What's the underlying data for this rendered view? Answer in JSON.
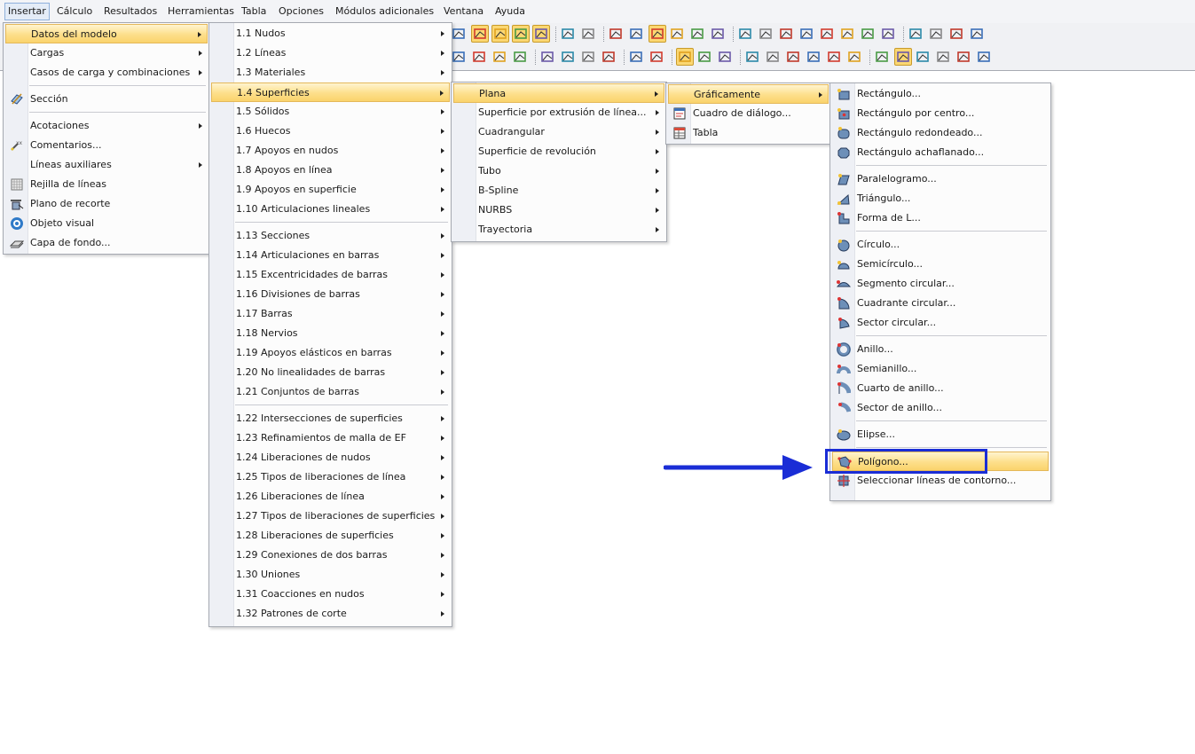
{
  "menubar": {
    "items": [
      {
        "label": "Insertar",
        "active": true
      },
      {
        "label": "Cálculo"
      },
      {
        "label": "Resultados"
      },
      {
        "label": "Herramientas"
      },
      {
        "label": "Tabla"
      },
      {
        "label": "Opciones"
      },
      {
        "label": "Módulos adicionales"
      },
      {
        "label": "Ventana"
      },
      {
        "label": "Ayuda"
      }
    ]
  },
  "toolbar": {
    "accent_highlight": "#fbd772",
    "row1_icons": [
      "chevron-right-icon",
      "node-select-icon",
      "xxx-label-icon",
      "view-icon",
      "xxx-values-icon",
      "rotate-icon",
      "frame-icon",
      "grid-icon",
      "grid-dots-icon",
      "mesh-icon",
      "support-icon",
      "move-icon",
      "structure-icon",
      "search-icon",
      "rotate-3d-icon",
      "circle-icon",
      "mirror-icon",
      "cross-icon",
      "cube-icon",
      "print-icon",
      "gear-icon",
      "flag-icon",
      "flag2-icon",
      "flag3-icon",
      "flag4-icon"
    ],
    "row2_icons": [
      "zoom-icon",
      "search-icon",
      "box-icon",
      "box2-icon",
      "axis-x-icon",
      "axis-y-icon",
      "axis-z-icon",
      "axis-iso-icon",
      "render-icon",
      "display-icon",
      "bracket-icon",
      "chain-icon",
      "result-icon",
      "color-icon",
      "solid-icon",
      "paint-icon",
      "layer-icon",
      "grid-icon",
      "hide-icon",
      "table-icon",
      "notes-icon",
      "wand-icon",
      "cancel-x-icon",
      "window-icon",
      "window2-icon"
    ]
  },
  "menu_insertar": {
    "items": [
      {
        "label": "Datos del modelo",
        "submenu": true,
        "highlighted": true,
        "icon": "none"
      },
      {
        "label": "Cargas",
        "submenu": true
      },
      {
        "label": "Casos de carga y combinaciones",
        "submenu": true
      },
      {
        "label": "Sección",
        "icon": "section-icon"
      },
      {
        "label": "Acotaciones",
        "submenu": true
      },
      {
        "label": "Comentarios...",
        "icon": "comment-icon"
      },
      {
        "label": "Líneas auxiliares",
        "submenu": true
      },
      {
        "label": "Rejilla de líneas",
        "icon": "grid-icon"
      },
      {
        "label": "Plano de recorte",
        "icon": "clip-plane-icon"
      },
      {
        "label": "Objeto visual",
        "icon": "visual-object-icon"
      },
      {
        "label": "Capa de fondo...",
        "icon": "background-layer-icon"
      }
    ]
  },
  "menu_datos": {
    "items": [
      {
        "label": "1.1 Nudos"
      },
      {
        "label": "1.2 Líneas"
      },
      {
        "label": "1.3 Materiales"
      },
      {
        "label": "1.4 Superficies",
        "highlighted": true
      },
      {
        "label": "1.5 Sólidos"
      },
      {
        "label": "1.6 Huecos"
      },
      {
        "label": "1.7 Apoyos en nudos"
      },
      {
        "label": "1.8 Apoyos en línea"
      },
      {
        "label": "1.9 Apoyos en superficie"
      },
      {
        "label": "1.10 Articulaciones lineales"
      },
      {
        "label": "1.13 Secciones"
      },
      {
        "label": "1.14 Articulaciones en barras"
      },
      {
        "label": "1.15 Excentricidades de barras"
      },
      {
        "label": "1.16 Divisiones de barras"
      },
      {
        "label": "1.17 Barras"
      },
      {
        "label": "1.18 Nervios"
      },
      {
        "label": "1.19 Apoyos elásticos en barras"
      },
      {
        "label": "1.20 No linealidades de barras"
      },
      {
        "label": "1.21 Conjuntos de barras"
      },
      {
        "label": "1.22 Intersecciones de superficies"
      },
      {
        "label": "1.23 Refinamientos de malla de EF"
      },
      {
        "label": "1.24 Liberaciones de nudos"
      },
      {
        "label": "1.25 Tipos de liberaciones de línea"
      },
      {
        "label": "1.26 Liberaciones de línea"
      },
      {
        "label": "1.27 Tipos de liberaciones de superficies"
      },
      {
        "label": "1.28 Liberaciones de superficies"
      },
      {
        "label": "1.29 Conexiones de dos barras"
      },
      {
        "label": "1.30 Uniones"
      },
      {
        "label": "1.31 Coacciones en nudos"
      },
      {
        "label": "1.32 Patrones de corte"
      }
    ]
  },
  "menu_superficies": {
    "items": [
      {
        "label": "Plana",
        "highlighted": true
      },
      {
        "label": "Superficie por extrusión de línea..."
      },
      {
        "label": "Cuadrangular"
      },
      {
        "label": "Superficie de revolución"
      },
      {
        "label": "Tubo"
      },
      {
        "label": "B-Spline"
      },
      {
        "label": "NURBS"
      },
      {
        "label": "Trayectoria"
      }
    ]
  },
  "menu_plana": {
    "items": [
      {
        "label": "Gráficamente",
        "submenu": true,
        "highlighted": true
      },
      {
        "label": "Cuadro de diálogo...",
        "icon": "dialog-icon"
      },
      {
        "label": "Tabla",
        "icon": "table-icon"
      }
    ]
  },
  "menu_graficamente": {
    "items": [
      {
        "label": "Rectángulo...",
        "icon": "rectangle-icon"
      },
      {
        "label": "Rectángulo por centro...",
        "icon": "rectangle-center-icon"
      },
      {
        "label": "Rectángulo redondeado...",
        "icon": "rounded-rectangle-icon"
      },
      {
        "label": "Rectángulo achaflanado...",
        "icon": "chamfered-rectangle-icon"
      },
      {
        "label": "Paralelogramo...",
        "icon": "parallelogram-icon"
      },
      {
        "label": "Triángulo...",
        "icon": "triangle-icon"
      },
      {
        "label": "Forma de L...",
        "icon": "l-shape-icon"
      },
      {
        "label": "Círculo...",
        "icon": "circle-icon"
      },
      {
        "label": "Semicírculo...",
        "icon": "semicircle-icon"
      },
      {
        "label": "Segmento circular...",
        "icon": "circular-segment-icon"
      },
      {
        "label": "Cuadrante circular...",
        "icon": "circular-quadrant-icon"
      },
      {
        "label": "Sector circular...",
        "icon": "circular-sector-icon"
      },
      {
        "label": "Anillo...",
        "icon": "ring-icon"
      },
      {
        "label": "Semianillo...",
        "icon": "half-ring-icon"
      },
      {
        "label": "Cuarto de anillo...",
        "icon": "quarter-ring-icon"
      },
      {
        "label": "Sector de anillo...",
        "icon": "ring-sector-icon"
      },
      {
        "label": "Elipse...",
        "icon": "ellipse-icon"
      },
      {
        "label": "Polígono...",
        "icon": "polygon-icon",
        "highlighted": true
      },
      {
        "label": "Seleccionar líneas de contorno...",
        "icon": "select-contour-icon"
      }
    ]
  },
  "annotation": {
    "arrow_color": "#1a2dd6",
    "box_color": "#1a2dd6"
  }
}
